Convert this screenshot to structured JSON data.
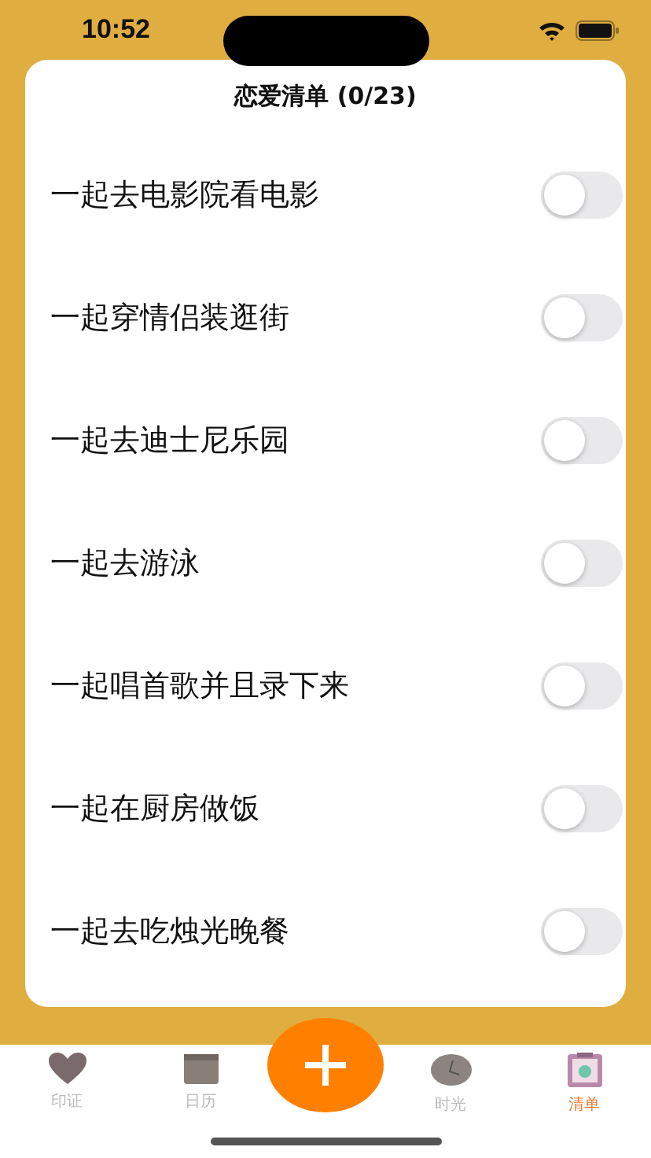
{
  "status_bar": {
    "time": "10:52"
  },
  "list": {
    "title": "恋爱清单 (0/23)",
    "items": [
      {
        "label": "一起去电影院看电影",
        "on": false
      },
      {
        "label": "一起穿情侣装逛街",
        "on": false
      },
      {
        "label": "一起去迪士尼乐园",
        "on": false
      },
      {
        "label": "一起去游泳",
        "on": false
      },
      {
        "label": "一起唱首歌并且录下来",
        "on": false
      },
      {
        "label": "一起在厨房做饭",
        "on": false
      },
      {
        "label": "一起去吃烛光晚餐",
        "on": false
      }
    ]
  },
  "tab_bar": {
    "tabs": [
      {
        "kind": "heart",
        "label": "印证",
        "selected": false
      },
      {
        "kind": "calendar",
        "label": "日历",
        "selected": false
      },
      {
        "kind": "add"
      },
      {
        "kind": "clock",
        "label": "时光",
        "selected": false
      },
      {
        "kind": "checklist",
        "label": "清单",
        "selected": true
      }
    ]
  }
}
